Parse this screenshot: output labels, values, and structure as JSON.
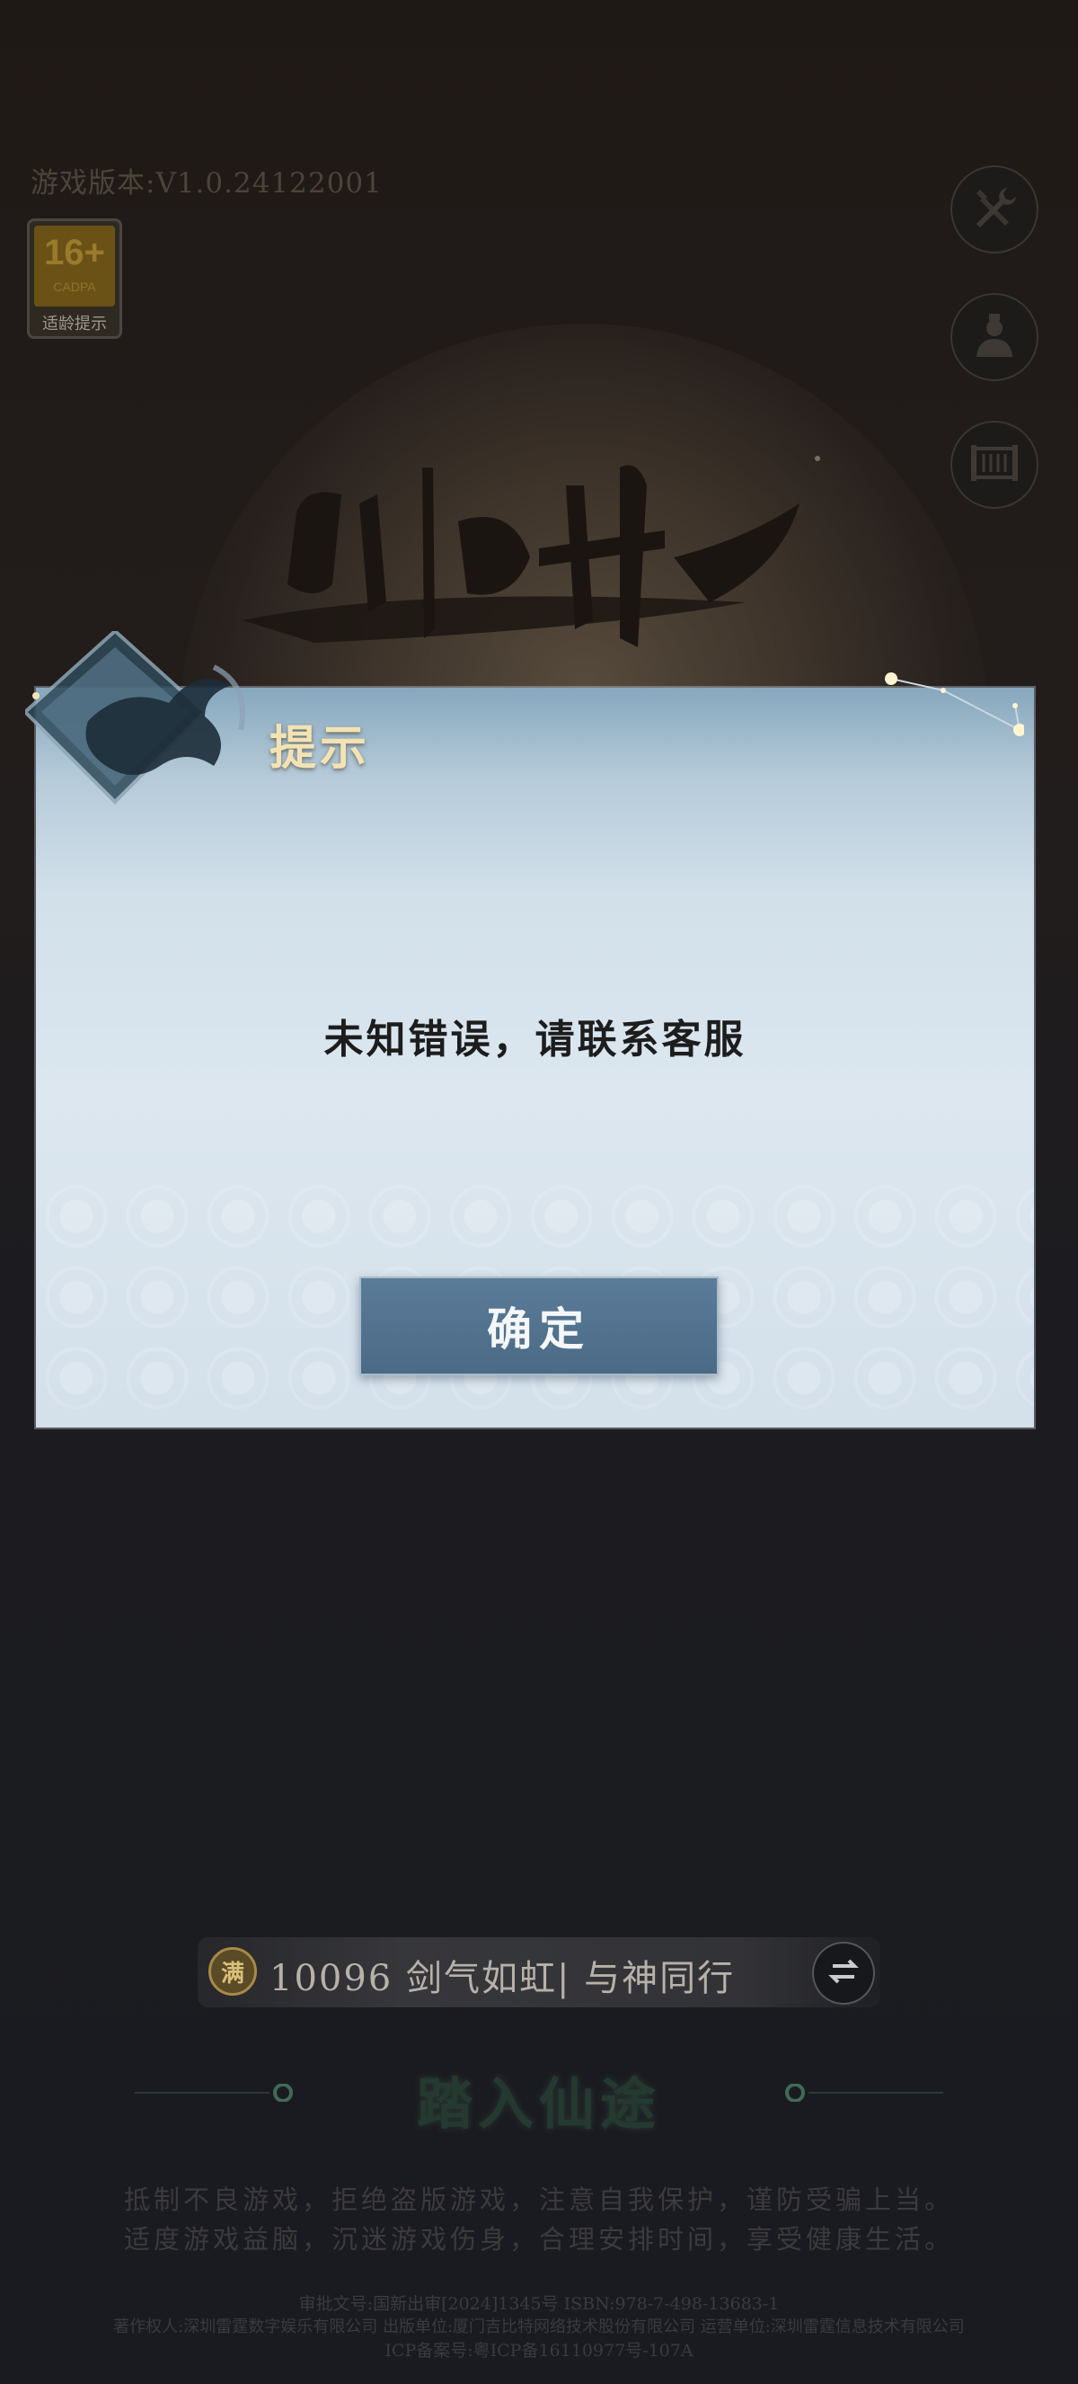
{
  "version_label": "游戏版本:V1.0.24122001",
  "age_rating": {
    "number": "16+",
    "org": "CADPA",
    "tip": "适龄提示"
  },
  "side_buttons": [
    {
      "icon": "tools-icon"
    },
    {
      "icon": "account-icon"
    },
    {
      "icon": "announcement-scroll-icon"
    }
  ],
  "dialog": {
    "title": "提示",
    "message": "未知错误，请联系客服",
    "confirm_label": "确定"
  },
  "server": {
    "icon_text": "满",
    "name": "10096 剑气如虹| 与神同行"
  },
  "enter_label": "踏入仙途",
  "health_notice": {
    "line1": "抵制不良游戏，拒绝盗版游戏，注意自我保护，谨防受骗上当。",
    "line2": "适度游戏益脑，沉迷游戏伤身，合理安排时间，享受健康生活。"
  },
  "legal": {
    "line1": "审批文号:国新出审[2024]1345号 ISBN:978-7-498-13683-1",
    "line2": "著作权人:深圳雷霆数字娱乐有限公司 出版单位:厦门吉比特网络技术股份有限公司 运营单位:深圳雷霆信息技术有限公司",
    "line3": "ICP备案号:粤ICP备16110977号-107A"
  },
  "colors": {
    "background": "#1f1b1a",
    "dialog_title": "#f3e3b4",
    "confirm_button": "#4f7089",
    "enter_text": "#24392f"
  }
}
